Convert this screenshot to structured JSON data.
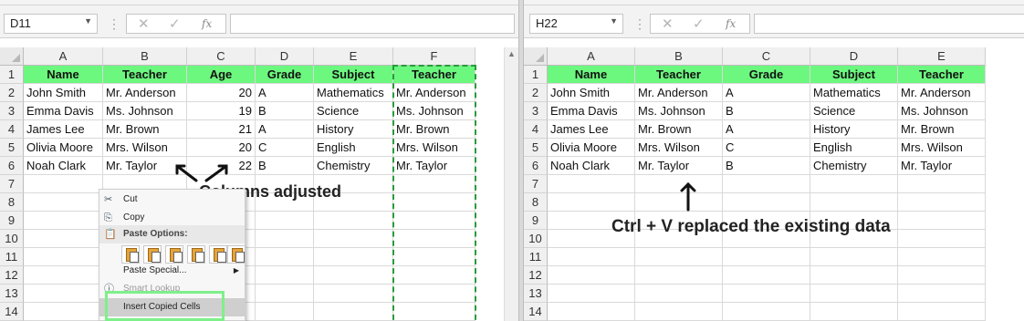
{
  "left": {
    "name_box": "D11",
    "columns": [
      "A",
      "B",
      "C",
      "D",
      "E",
      "F"
    ],
    "rows": [
      "1",
      "2",
      "3",
      "4",
      "5",
      "6",
      "7",
      "8",
      "9",
      "10",
      "11",
      "12",
      "13",
      "14"
    ],
    "headers": [
      "Name",
      "Teacher",
      "Age",
      "Grade",
      "Subject",
      "Teacher"
    ],
    "data": [
      [
        "John Smith",
        "Mr. Anderson",
        "20",
        "A",
        "Mathematics",
        "Mr. Anderson"
      ],
      [
        "Emma Davis",
        "Ms. Johnson",
        "19",
        "B",
        "Science",
        "Ms. Johnson"
      ],
      [
        "James Lee",
        "Mr. Brown",
        "21",
        "A",
        "History",
        "Mr. Brown"
      ],
      [
        "Olivia Moore",
        "Mrs. Wilson",
        "20",
        "C",
        "English",
        "Mrs. Wilson"
      ],
      [
        "Noah Clark",
        "Mr. Taylor",
        "22",
        "B",
        "Chemistry",
        "Mr. Taylor"
      ]
    ],
    "annotation": "Columns adjusted",
    "context_menu": {
      "cut": "Cut",
      "copy": "Copy",
      "paste_options": "Paste Options:",
      "paste_special": "Paste Special...",
      "smart_lookup": "Smart Lookup",
      "insert_copied_cells": "Insert Copied Cells"
    }
  },
  "right": {
    "name_box": "H22",
    "columns": [
      "A",
      "B",
      "C",
      "D",
      "E"
    ],
    "rows": [
      "1",
      "2",
      "3",
      "4",
      "5",
      "6",
      "7",
      "8",
      "9",
      "10",
      "11",
      "12",
      "13",
      "14"
    ],
    "headers": [
      "Name",
      "Teacher",
      "Grade",
      "Subject",
      "Teacher"
    ],
    "data": [
      [
        "John Smith",
        "Mr. Anderson",
        "A",
        "Mathematics",
        "Mr. Anderson"
      ],
      [
        "Emma Davis",
        "Ms. Johnson",
        "B",
        "Science",
        "Ms. Johnson"
      ],
      [
        "James Lee",
        "Mr. Brown",
        "A",
        "History",
        "Mr. Brown"
      ],
      [
        "Olivia Moore",
        "Mrs. Wilson",
        "C",
        "English",
        "Mrs. Wilson"
      ],
      [
        "Noah Clark",
        "Mr. Taylor",
        "B",
        "Chemistry",
        "Mr. Taylor"
      ]
    ],
    "annotation": "Ctrl + V replaced the existing data"
  },
  "formula_bar": {
    "cancel_icon": "✕",
    "enter_icon": "✓",
    "fx": "fx"
  },
  "colors": {
    "header_fill": "#6cf77f",
    "copy_border": "#2a9a3c",
    "highlight": "#7ef08a"
  }
}
